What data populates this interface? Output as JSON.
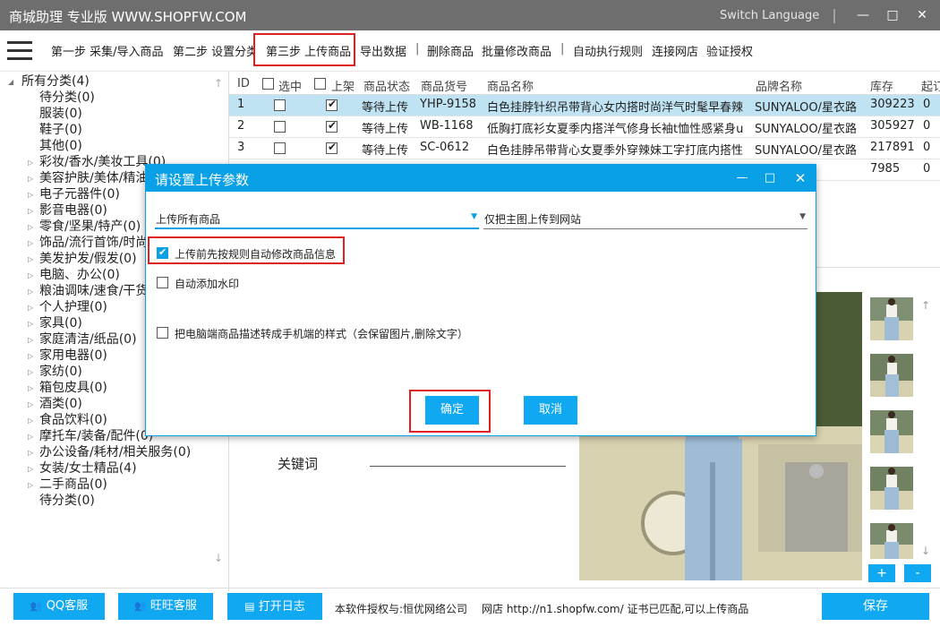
{
  "title_bar": {
    "app_title": "商城助理 专业版 WWW.SHOPFW.COM",
    "switch_language": "Switch Language",
    "minimize": "—",
    "maximize": "□",
    "close": "✕"
  },
  "menu": {
    "items": [
      "第一步 采集/导入商品",
      "第二步 设置分类",
      "第三步 上传商品",
      "导出数据",
      "删除商品",
      "批量修改商品",
      "执行规则",
      "执行规则",
      "自动执行规则",
      "连接网店",
      "验证授权"
    ]
  },
  "tree": {
    "root": "所有分类(4)",
    "items": [
      "待分类(0)",
      "服装(0)",
      "鞋子(0)",
      "其他(0)",
      "彩妆/香水/美妆工具(0)",
      "美容护肤/美体/精油",
      "电子元器件(0)",
      "影音电器(0)",
      "零食/坚果/特产(0)",
      "饰品/流行首饰/时尚",
      "美发护发/假发(0)",
      "电脑、办公(0)",
      "粮油调味/速食/干货",
      "个人护理(0)",
      "家具(0)",
      "家庭清洁/纸品(0)",
      "家用电器(0)",
      "家纺(0)",
      "箱包皮具(0)",
      "酒类(0)",
      "食品饮料(0)",
      "摩托车/装备/配件(0)",
      "办公设备/耗材/相关服务(0)",
      "女装/女士精品(4)",
      "二手商品(0)",
      "待分类(0)"
    ]
  },
  "grid": {
    "headers": {
      "id": "ID",
      "selected": "选中",
      "listed": "上架",
      "status": "商品状态",
      "code": "商品货号",
      "name": "商品名称",
      "brand": "品牌名称",
      "stock": "库存",
      "extra": "起订"
    },
    "rows": [
      {
        "id": "1",
        "status": "等待上传",
        "code": "YHP-9158",
        "name": "白色挂脖针织吊带背心女内搭时尚洋气时髦早春辣",
        "brand": "SUNYALOO/星衣路",
        "stock": "309223",
        "extra": "0"
      },
      {
        "id": "2",
        "status": "等待上传",
        "code": "WB-1168",
        "name": "低胸打底衫女夏季内搭洋气修身长袖t恤性感紧身u",
        "brand": "SUNYALOO/星衣路",
        "stock": "305927",
        "extra": "0"
      },
      {
        "id": "3",
        "status": "等待上传",
        "code": "SC-0612",
        "name": "白色挂脖吊带背心女夏季外穿辣妹工字打底内搭性",
        "brand": "SUNYALOO/星衣路",
        "stock": "217891",
        "extra": "0"
      },
      {
        "id": "4",
        "status": "",
        "code": "",
        "name": "",
        "brand": "",
        "stock": "7985",
        "extra": "0"
      }
    ]
  },
  "dialog": {
    "title": "请设置上传参数",
    "select1": "上传所有商品",
    "select2": "仅把主图上传到网站",
    "opt1": "上传前先按规则自动修改商品信息",
    "opt2": "自动添加水印",
    "opt3": "把电脑端商品描述转成手机端的样式（会保留图片,删除文字）",
    "ok": "确定",
    "cancel": "取消"
  },
  "detail": {
    "keyword_label": "关键词",
    "plus": "+",
    "minus": "-"
  },
  "bottom": {
    "qq": "QQ客服",
    "wangwang": "旺旺客服",
    "log": "打开日志",
    "license": "本软件授权与:恒优网络公司",
    "shop": "网店 http://n1.shopfw.com/ 证书已匹配,可以上传商品",
    "save": "保存"
  },
  "colors": {
    "accent": "#0aa0e6",
    "highlight": "#e02020",
    "titlebar": "#6e6e6e",
    "row_selected": "#bfe3f2"
  }
}
